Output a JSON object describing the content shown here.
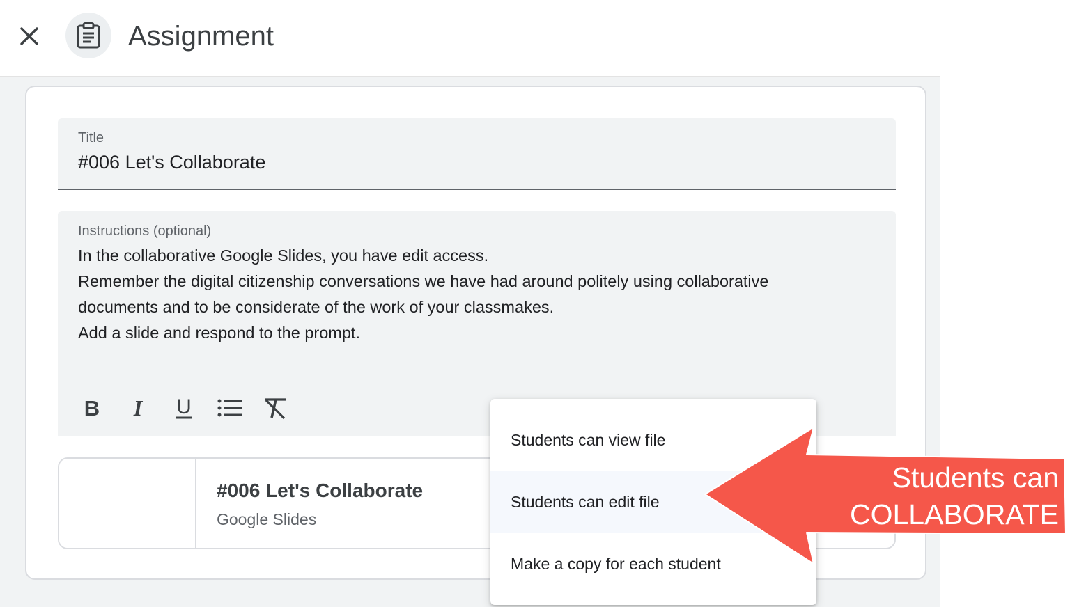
{
  "header": {
    "title": "Assignment",
    "close_icon": "close-icon",
    "assignment_icon": "clipboard-icon"
  },
  "form": {
    "title_label": "Title",
    "title_value": "#006 Let's Collaborate",
    "instructions_label": "Instructions (optional)",
    "instructions_lines": [
      "In the collaborative Google Slides, you have edit access.",
      "Remember the digital citizenship conversations we have had around politely using collaborative",
      "documents and to be considerate of the work of your classmakes.",
      "Add a slide and respond to the prompt."
    ],
    "toolbar": [
      {
        "name": "bold-icon",
        "label": "B"
      },
      {
        "name": "italic-icon",
        "label": "I"
      },
      {
        "name": "underline-icon",
        "label": "U"
      },
      {
        "name": "bulleted-list-icon"
      },
      {
        "name": "clear-formatting-icon"
      }
    ]
  },
  "attachment": {
    "title": "#006 Let's Collaborate",
    "subtitle": "Google Slides"
  },
  "menu": {
    "items": [
      {
        "label": "Students can view file",
        "highlighted": false
      },
      {
        "label": "Students can edit file",
        "highlighted": true
      },
      {
        "label": "Make a copy for each student",
        "highlighted": false
      }
    ]
  },
  "annotation": {
    "line1": "Students can",
    "line2": "COLLABORATE",
    "color": "#f5574a"
  },
  "colors": {
    "background": "#f1f3f4",
    "field_background": "#f1f3f4",
    "border": "#dadce0",
    "text_primary": "#202124",
    "text_secondary": "#5f6368"
  }
}
